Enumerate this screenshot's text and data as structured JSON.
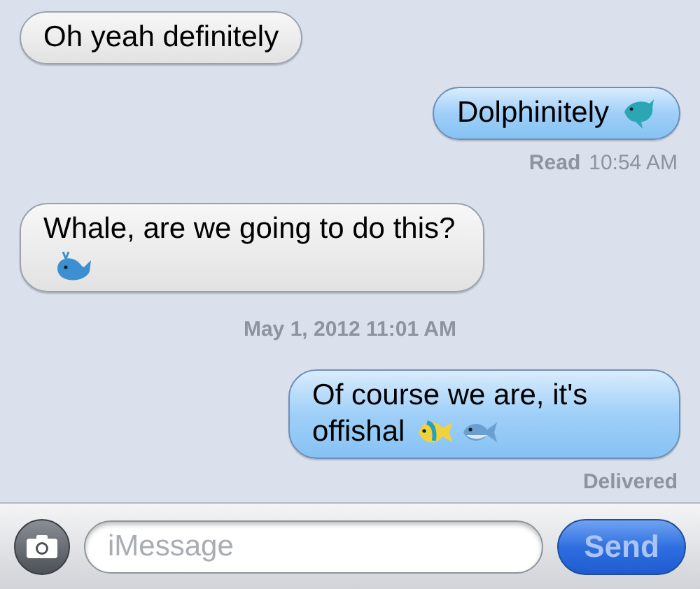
{
  "messages": [
    {
      "kind": "incoming",
      "text": "Oh yeah definitely"
    },
    {
      "kind": "outgoing",
      "text": "Dolphinitely",
      "status": {
        "label": "Read",
        "time": "10:54 AM"
      }
    },
    {
      "kind": "incoming",
      "text": "Whale, are we going to do this?"
    },
    {
      "kind": "timestamp",
      "text": "May 1, 2012 11:01 AM"
    },
    {
      "kind": "outgoing",
      "text": "Of course we are, it's offishal",
      "status": {
        "label": "Delivered"
      }
    }
  ],
  "input": {
    "placeholder": "iMessage"
  },
  "send_button": "Send"
}
